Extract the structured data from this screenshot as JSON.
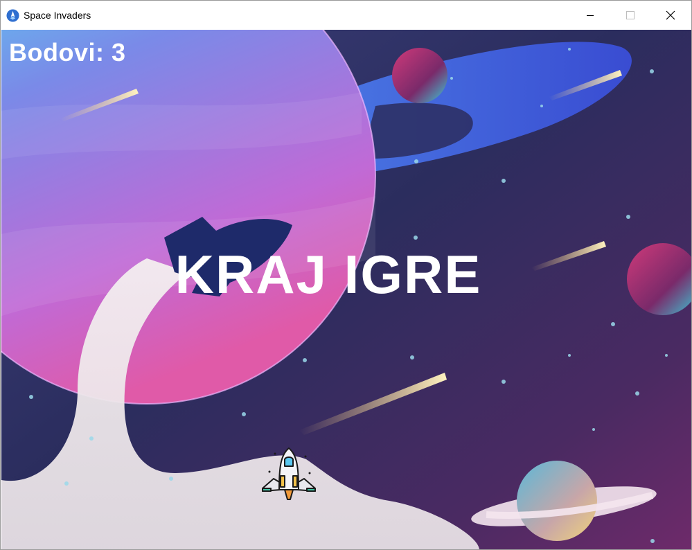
{
  "window": {
    "title": "Space Invaders",
    "icon": "rocket-icon"
  },
  "controls": {
    "minimize_icon": "minimize-icon",
    "maximize_icon": "maximize-icon",
    "close_icon": "close-icon"
  },
  "hud": {
    "score_text": "Bodovi: 3"
  },
  "game_over": {
    "text": "KRAJ IGRE"
  },
  "player": {
    "icon": "spaceship-icon"
  },
  "colors": {
    "bg_dark": "#2a2c5c",
    "bg_purple": "#6a2a6a",
    "planet_pink": "#c86ad8",
    "ring_blue": "#4a5ee8",
    "text": "#ffffff"
  }
}
